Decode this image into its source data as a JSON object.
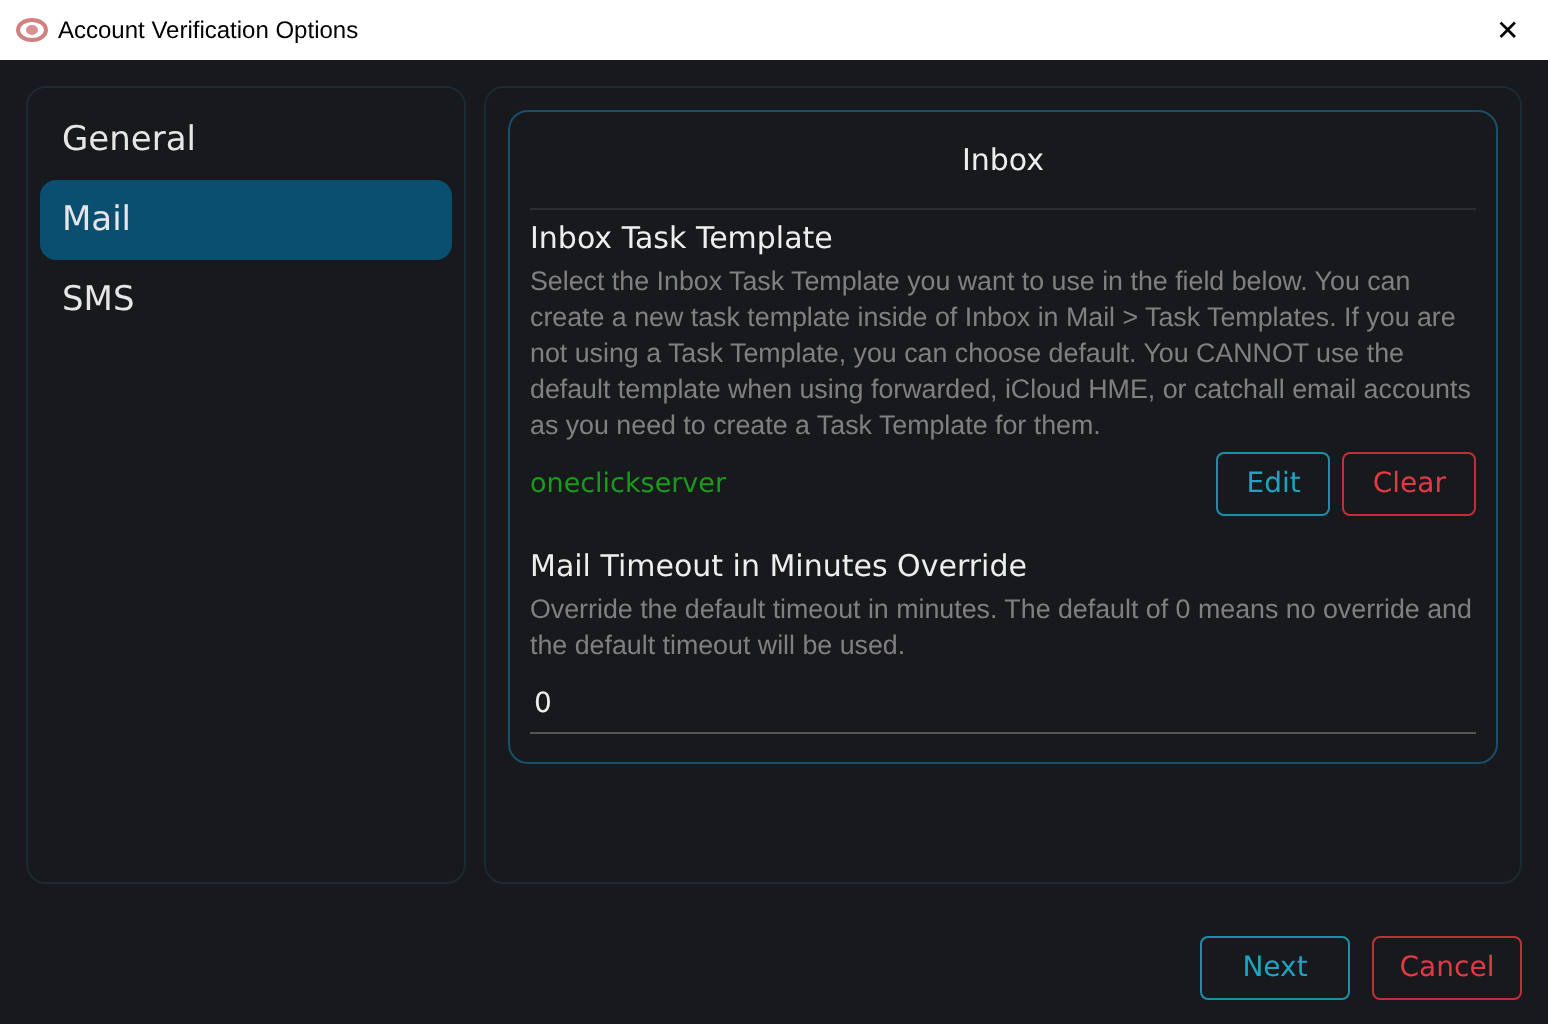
{
  "window": {
    "title": "Account Verification Options",
    "close": "✕"
  },
  "sidebar": {
    "items": [
      {
        "label": "General",
        "selected": false
      },
      {
        "label": "Mail",
        "selected": true
      },
      {
        "label": "SMS",
        "selected": false
      }
    ]
  },
  "card": {
    "title": "Inbox",
    "sections": [
      {
        "kind": "template",
        "heading": "Inbox Task Template",
        "description": "Select the Inbox Task Template you want to use in the field below. You can create a new task template inside of Inbox in Mail > Task Templates. If you are not using a Task Template, you can choose default. You CANNOT use the default template when using forwarded, iCloud HME, or catchall email accounts as you need to create a Task Template for them.",
        "value": "oneclickserver",
        "buttons": [
          {
            "label": "Edit",
            "kind": "primary"
          },
          {
            "label": "Clear",
            "kind": "danger"
          }
        ]
      },
      {
        "kind": "input",
        "heading": "Mail Timeout in Minutes Override",
        "description": "Override the default timeout in minutes. The default of 0 means no override and the default timeout will be used.",
        "value": "0"
      }
    ]
  },
  "footer": {
    "buttons": [
      {
        "label": "Next",
        "kind": "primary"
      },
      {
        "label": "Cancel",
        "kind": "danger"
      }
    ]
  }
}
